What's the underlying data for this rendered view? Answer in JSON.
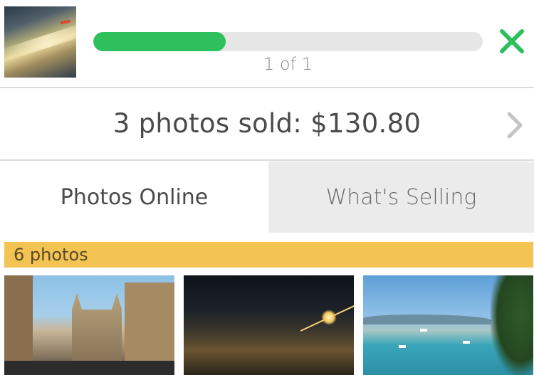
{
  "upload": {
    "progress_fraction": 0.34,
    "progress_text": "1 of 1",
    "accent_color": "#2ec05c",
    "close_icon": "close-x-icon"
  },
  "sales": {
    "summary": "3 photos sold: $130.80",
    "chevron_icon": "chevron-right-icon"
  },
  "tabs": [
    {
      "label": "Photos Online",
      "active": true
    },
    {
      "label": "What's Selling",
      "active": false
    }
  ],
  "photos": {
    "count_label": "6 photos",
    "count_bar_color": "#f3c452",
    "items": [
      {
        "alt": "cathedral"
      },
      {
        "alt": "sunset"
      },
      {
        "alt": "bay"
      }
    ]
  }
}
